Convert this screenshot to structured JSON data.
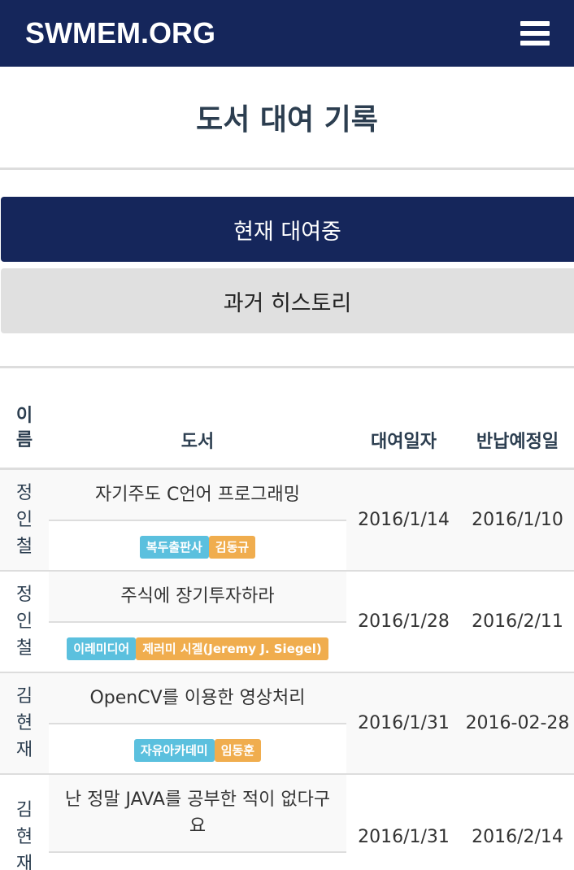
{
  "nav": {
    "brand": "SWMEM.ORG"
  },
  "page": {
    "title": "도서 대여 기록"
  },
  "tabs": {
    "current": "현재 대여중",
    "history": "과거 히스토리"
  },
  "table": {
    "headers": {
      "name": "이름",
      "book": "도서",
      "loan_date": "대여일자",
      "due_date": "반납예정일"
    },
    "rows": [
      {
        "name": "정인철",
        "title": "자기주도 C언어 프로그래밍",
        "publisher": "복두출판사",
        "author": "김동규",
        "loan_date": "2016/1/14",
        "due_date": "2016/1/10"
      },
      {
        "name": "정인철",
        "title": "주식에 장기투자하라",
        "publisher": "이레미디어",
        "author": "제러미 시겔(Jeremy J. Siegel)",
        "loan_date": "2016/1/28",
        "due_date": "2016/2/11"
      },
      {
        "name": "김현재",
        "title": "OpenCV를 이용한 영상처리",
        "publisher": "자유아카데미",
        "author": "임동훈",
        "loan_date": "2016/1/31",
        "due_date": "2016-02-28"
      },
      {
        "name": "김현재",
        "title": "난 정말 JAVA를 공부한 적이 없다구요",
        "publisher": "",
        "author": "",
        "loan_date": "2016/1/31",
        "due_date": "2016/2/14"
      }
    ]
  }
}
